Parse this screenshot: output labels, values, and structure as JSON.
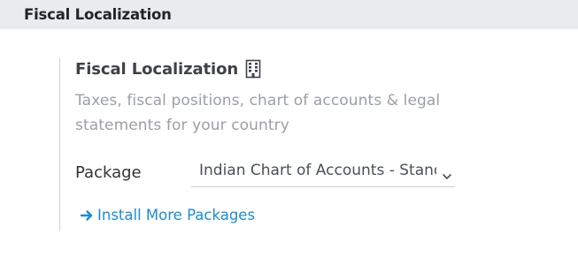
{
  "section": {
    "title": "Fiscal Localization"
  },
  "setting": {
    "title": "Fiscal Localization",
    "description": "Taxes, fiscal positions, chart of accounts & legal statements for your country",
    "package_label": "Package",
    "package_value": "Indian Chart of Accounts - Standard",
    "install_link_label": "Install More Packages"
  },
  "icons": {
    "title_icon": "building-icon",
    "dropdown_icon": "chevron-down-icon",
    "link_icon": "arrow-right-icon"
  },
  "colors": {
    "header_bg": "#e9ecef",
    "link": "#1a8cd8",
    "muted_text": "#9aa0a6"
  }
}
